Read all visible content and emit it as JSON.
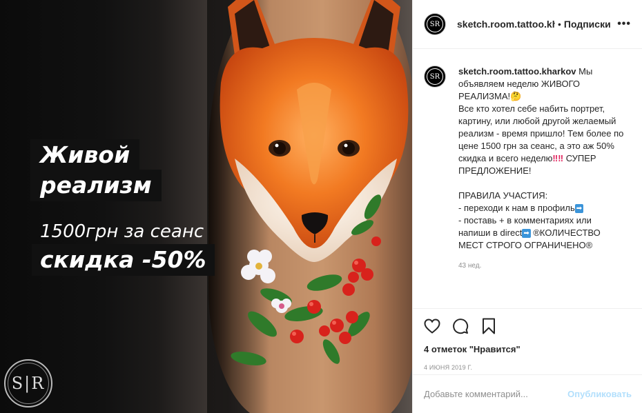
{
  "image": {
    "caption_line1": "Живой",
    "caption_line2": "реализм",
    "caption_line3": "1500грн за сеанс",
    "caption_line4": "скидка -50%",
    "logo_letters": "S|R"
  },
  "header": {
    "username": "sketch.room.tattoo.kharkov",
    "separator": "•",
    "follow_label": "Подписки",
    "more_label": "•••",
    "avatar_letters": "SR"
  },
  "post": {
    "username": "sketch.room.tattoo.kharkov",
    "text_part1": " Мы объявляем неделю ЖИВОГО РЕАЛИЗМА!🤔\nВсе кто хотел себе набить портрет, картину, или любой другой желаемый реализм - время пришло! Тем более по цене 1500 грн за сеанс, а это аж 50% скидка и всего неделю",
    "text_exclaim": "‼‼",
    "text_part2": " СУПЕР ПРЕДЛОЖЕНИЕ!\n\nПРАВИЛА УЧАСТИЯ:\n- переходи к нам в профиль",
    "arrow_label": "➡",
    "text_part3": "\n- поставь + в комментариях или напиши в direct",
    "text_part4": " ®КОЛИЧЕСТВО МЕСТ СТРОГО ОГРАНИЧЕНО®",
    "time": "43 нед."
  },
  "actions": {
    "like_icon": "heart-icon",
    "comment_icon": "comment-icon",
    "bookmark_icon": "bookmark-icon"
  },
  "likes_text": "4 отметок \"Нравится\"",
  "date": "4 ИЮНЯ 2019 Г.",
  "comment_box": {
    "placeholder": "Добавьте комментарий...",
    "publish_label": "Опубликовать"
  },
  "colors": {
    "link": "#b2dffc",
    "text": "#262626",
    "muted": "#8e8e8e"
  }
}
